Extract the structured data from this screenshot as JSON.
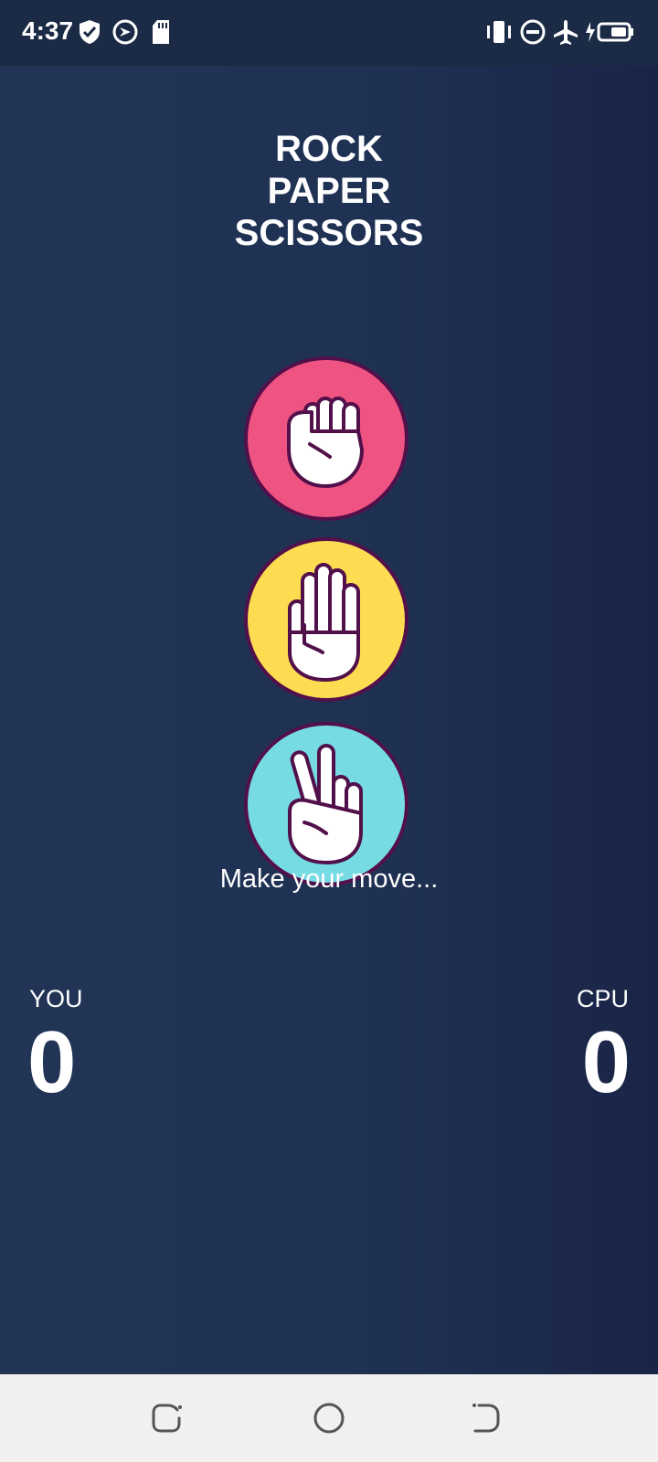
{
  "status_bar": {
    "time": "4:37",
    "left_icons": [
      "shield-check-icon",
      "location-sync-icon",
      "sd-card-icon"
    ],
    "right_icons": [
      "vibrate-icon",
      "do-not-disturb-icon",
      "airplane-icon",
      "battery-charging-icon"
    ]
  },
  "game": {
    "title_lines": [
      "ROCK",
      "PAPER",
      "SCISSORS"
    ],
    "moves": [
      {
        "id": "rock",
        "icon": "fist-icon",
        "color": "#ef5382"
      },
      {
        "id": "paper",
        "icon": "open-hand-icon",
        "color": "#fddc52"
      },
      {
        "id": "scissors",
        "icon": "peace-hand-icon",
        "color": "#77dbe4"
      }
    ],
    "prompt": "Make your move...",
    "score": {
      "player_label": "YOU",
      "player_value": "0",
      "cpu_label": "CPU",
      "cpu_value": "0"
    }
  },
  "nav_bar": {
    "buttons": [
      "recents-icon",
      "home-icon",
      "back-icon"
    ]
  },
  "colors": {
    "background": "#1f3153",
    "status_bar": "#1b2a45",
    "nav_bar": "#f0f0f0",
    "icon_outline": "#52104a"
  }
}
